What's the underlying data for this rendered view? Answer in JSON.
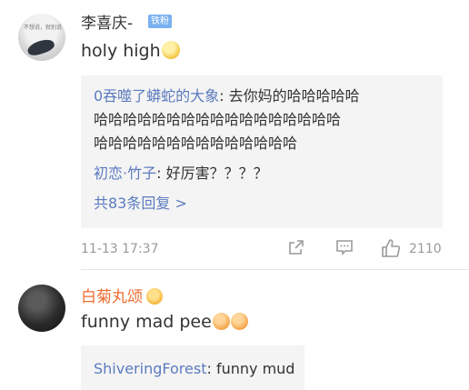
{
  "comment1": {
    "username": "李喜庆-",
    "badge": "铁粉",
    "avatar_caption": "不想说，就别说",
    "text": "holy high",
    "replies": {
      "r1_user": "0吞噬了蟒蛇的大象",
      "r1_text_line1": ": 去你妈的哈哈哈哈哈",
      "r1_line2": "哈哈哈哈哈哈哈哈哈哈哈哈哈哈哈哈哈",
      "r1_line3": "哈哈哈哈哈哈哈哈哈哈哈哈哈哈",
      "r2_user": "初恋·竹子",
      "r2_text": ": 好厉害？？？？",
      "more_label": "共83条回复 >"
    },
    "time": "11-13 17:37",
    "likes": "2110"
  },
  "comment2": {
    "username": "白菊丸颂",
    "text": "funny mad pee",
    "reply": {
      "user": "ShiveringForest",
      "text": ": funny mud"
    }
  },
  "colors": {
    "link": "#5b7bbf",
    "badge_bg": "#7ab1ef",
    "username2": "#f06a2f",
    "reply_bg": "#f4f4f4",
    "meta": "#999999"
  },
  "icons": {
    "share": "share-icon",
    "comment": "comment-icon",
    "like": "thumbs-up-icon",
    "emoji1": "smile-emoji-icon",
    "emoji2": "blush-emoji-icon",
    "crown": "crown-icon"
  }
}
